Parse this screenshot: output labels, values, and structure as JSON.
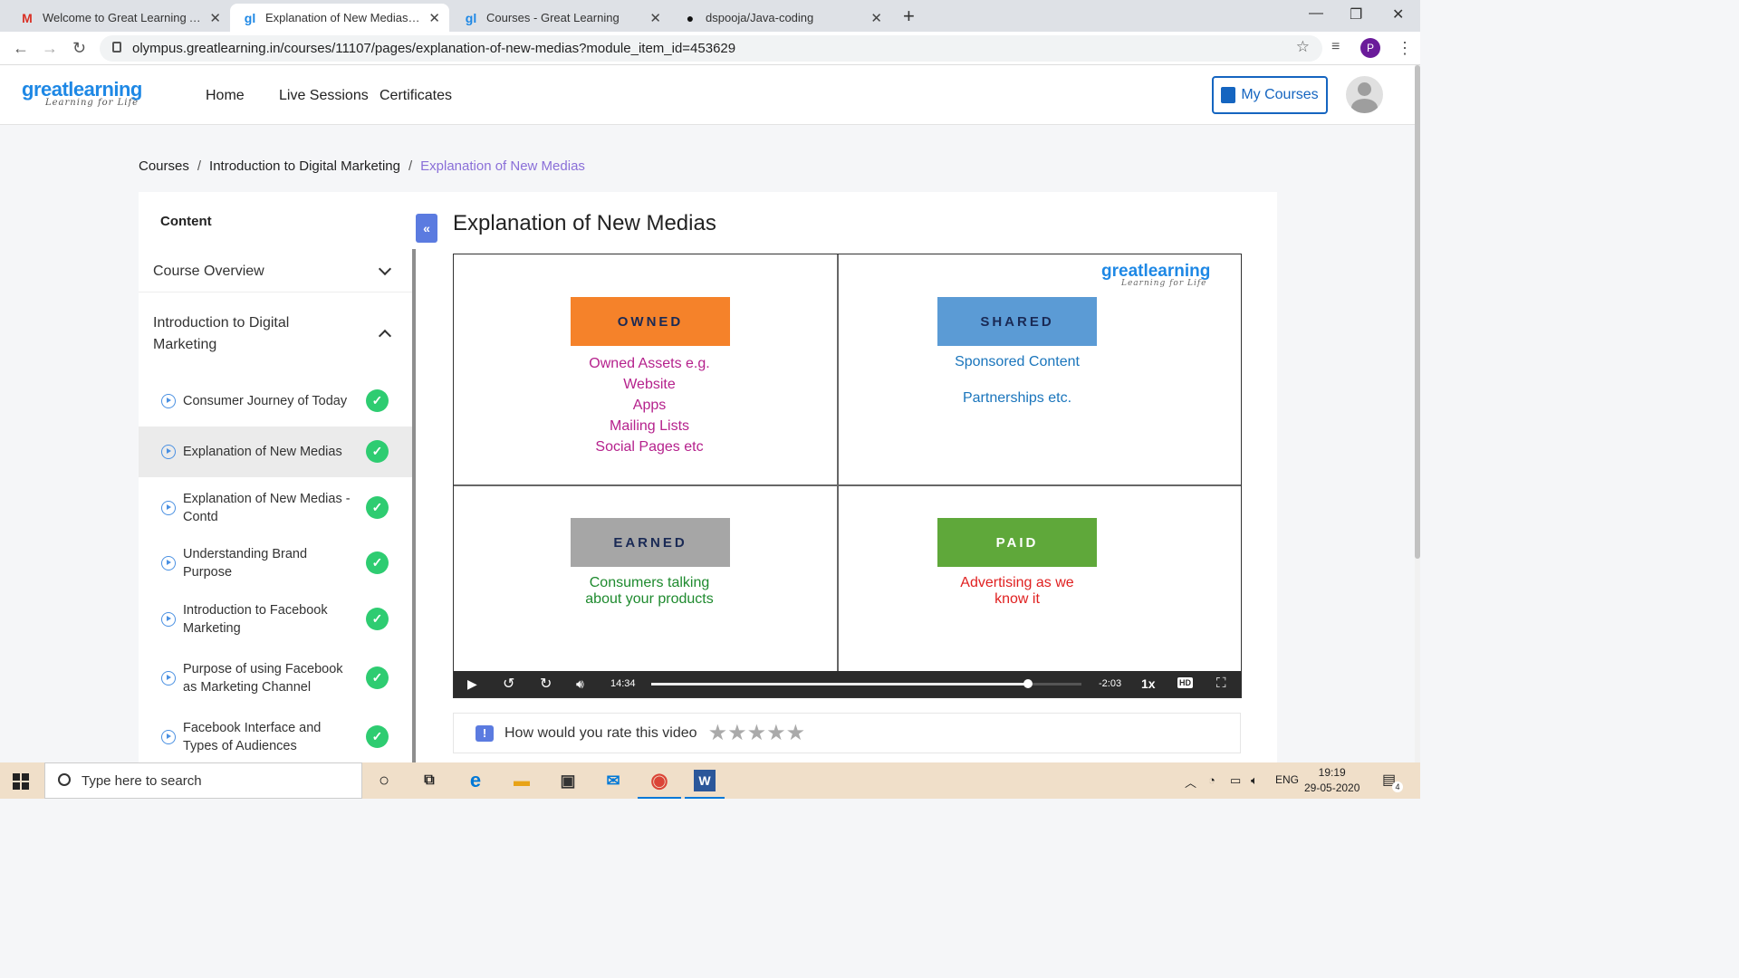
{
  "browser": {
    "tabs": [
      {
        "title": "Welcome to Great Learning Acad",
        "icon": "gmail-icon"
      },
      {
        "title": "Explanation of New Medias: Intro",
        "icon": "greatlearning-icon"
      },
      {
        "title": "Courses - Great Learning",
        "icon": "greatlearning-icon"
      },
      {
        "title": "dspooja/Java-coding",
        "icon": "github-icon"
      }
    ],
    "url": "olympus.greatlearning.in/courses/11107/pages/explanation-of-new-medias?module_item_id=453629",
    "profile_initial": "P"
  },
  "site": {
    "logo_main": "greatlearning",
    "logo_tagline": "Learning for Life",
    "nav": [
      "Home",
      "Live Sessions",
      "Certificates"
    ],
    "my_courses": "My Courses"
  },
  "breadcrumb": {
    "items": [
      "Courses",
      "Introduction to Digital Marketing"
    ],
    "separator": "/",
    "current": "Explanation of New Medias"
  },
  "sidebar": {
    "title": "Content",
    "sections": [
      "Course Overview",
      "Introduction to Digital Marketing"
    ],
    "lessons": [
      "Consumer Journey of Today",
      "Explanation of New Medias",
      "Explanation of New Medias - Contd",
      "Understanding Brand Purpose",
      "Introduction to Facebook Marketing",
      "Purpose of using Facebook as Marketing Channel",
      "Facebook Interface and Types of Audiences"
    ],
    "collapse_glyph": "«"
  },
  "page": {
    "title": "Explanation of New Medias"
  },
  "video": {
    "logo_main": "greatlearning",
    "logo_tagline": "Learning for Life",
    "quadrants": [
      {
        "label": "OWNED",
        "color": "#f5822a",
        "text_color": "#b5218c",
        "lines": [
          "Owned Assets e.g.",
          "Website",
          "Apps",
          "Mailing Lists",
          "Social Pages etc"
        ]
      },
      {
        "label": "SHARED",
        "color": "#5b9bd5",
        "text_color": "#1a75bc",
        "lines": [
          "Sponsored Content",
          "",
          "Partnerships etc."
        ]
      },
      {
        "label": "EARNED",
        "color": "#a6a6a6",
        "text_color": "#1e8a2e",
        "lines": [
          "Consumers talking",
          "about your products"
        ]
      },
      {
        "label": "PAID",
        "color": "#5fa83a",
        "text_color": "#e02020",
        "lines": [
          "Advertising as we",
          "know it"
        ]
      }
    ],
    "time_elapsed": "14:34",
    "time_remaining": "-2:03",
    "speed": "1x",
    "hd": "HD",
    "progress": 0.875
  },
  "rating": {
    "prompt": "How would you rate this video",
    "icon": "!",
    "stars": 5
  },
  "taskbar": {
    "search_placeholder": "Type here to search",
    "language": "ENG",
    "time": "19:19",
    "date": "29-05-2020",
    "notifications": "4"
  }
}
